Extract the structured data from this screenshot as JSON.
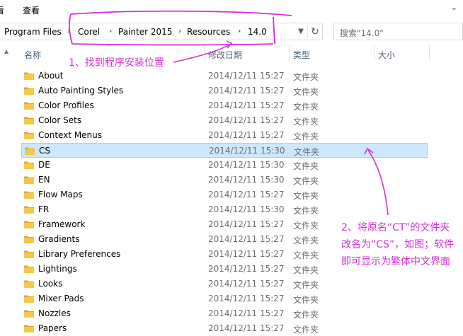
{
  "menu": {
    "left_partial": "看",
    "view": "查看",
    "expand_arrow": "⌄"
  },
  "address": {
    "crumbs": [
      "Program Files",
      "Corel",
      "Painter 2015",
      "Resources",
      "14.0"
    ],
    "separator": "›"
  },
  "search": {
    "placeholder": "搜索\"14.0\""
  },
  "columns": {
    "name": "名称",
    "modified": "修改日期",
    "type": "类型",
    "size": "大小"
  },
  "files": [
    {
      "name": "About",
      "date": "2014/12/11 15:27",
      "type": "文件夹"
    },
    {
      "name": "Auto Painting Styles",
      "date": "2014/12/11 15:27",
      "type": "文件夹"
    },
    {
      "name": "Color Profiles",
      "date": "2014/12/11 15:27",
      "type": "文件夹"
    },
    {
      "name": "Color Sets",
      "date": "2014/12/11 15:27",
      "type": "文件夹"
    },
    {
      "name": "Context Menus",
      "date": "2014/12/11 15:27",
      "type": "文件夹"
    },
    {
      "name": "CS",
      "date": "2014/12/11 15:30",
      "type": "文件夹",
      "selected": true
    },
    {
      "name": "DE",
      "date": "2014/12/11 15:30",
      "type": "文件夹"
    },
    {
      "name": "EN",
      "date": "2014/12/11 15:30",
      "type": "文件夹"
    },
    {
      "name": "Flow Maps",
      "date": "2014/12/11 15:27",
      "type": "文件夹"
    },
    {
      "name": "FR",
      "date": "2014/12/11 15:30",
      "type": "文件夹"
    },
    {
      "name": "Framework",
      "date": "2014/12/11 15:27",
      "type": "文件夹"
    },
    {
      "name": "Gradients",
      "date": "2014/12/11 15:27",
      "type": "文件夹"
    },
    {
      "name": "Library Preferences",
      "date": "2014/12/11 15:27",
      "type": "文件夹"
    },
    {
      "name": "Lightings",
      "date": "2014/12/11 15:27",
      "type": "文件夹"
    },
    {
      "name": "Looks",
      "date": "2014/12/11 15:27",
      "type": "文件夹"
    },
    {
      "name": "Mixer Pads",
      "date": "2014/12/11 15:27",
      "type": "文件夹"
    },
    {
      "name": "Nozzles",
      "date": "2014/12/11 15:27",
      "type": "文件夹"
    },
    {
      "name": "Papers",
      "date": "2014/12/11 15:27",
      "type": "文件夹"
    }
  ],
  "annotations": {
    "step1": "1、找到程序安装位置",
    "step2_line1": "2、将原名“CT”的文件夹",
    "step2_line2": "改名为“CS”，如图；软件",
    "step2_line3": "即可显示为繁体中文界面",
    "color": "#d62fd6"
  },
  "colors": {
    "selected_bg": "#cce8ff",
    "selected_border": "#99d1ff",
    "folder": "#e8c04a",
    "header_text": "#4c607a"
  }
}
